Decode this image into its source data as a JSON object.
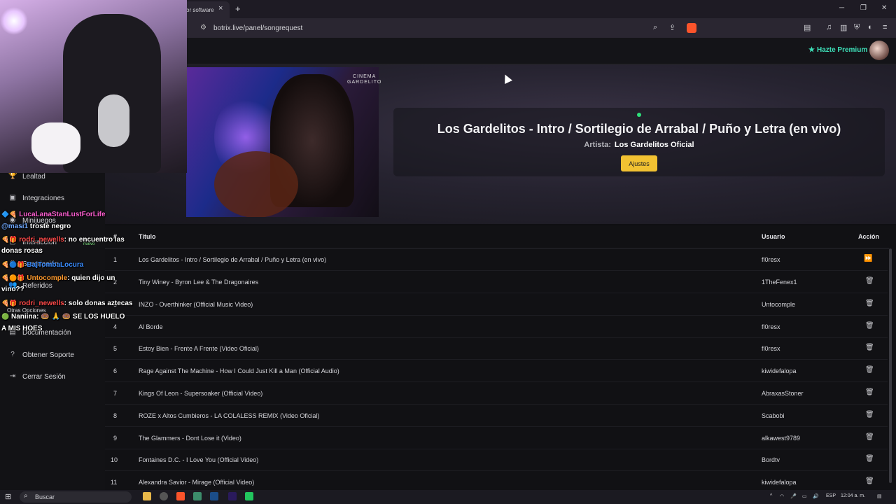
{
  "browser": {
    "tab_title": "or software",
    "tab_close": "×",
    "new_tab": "+",
    "url": "botrix.live/panel/songrequest",
    "win_min": "─",
    "win_max": "❐",
    "win_close": "✕"
  },
  "header": {
    "premium_label": "Hazte Premium"
  },
  "now_playing": {
    "video_watermark_line1": "CINEMA",
    "video_watermark_line2": "GARDELITO",
    "title": "Los Gardelitos - Intro / Sortilegio de Arrabal / Puño y Letra (en vivo)",
    "artist_label": "Artista:",
    "artist": "Los Gardelitos Oficial",
    "settings_button": "Ajustes"
  },
  "sidebar": {
    "items": [
      {
        "label": "Lealtad",
        "icon": "trophy-icon"
      },
      {
        "label": "Integraciones",
        "icon": "puzzle-icon"
      },
      {
        "label": "Minijuegos",
        "icon": "gamepad-icon"
      },
      {
        "label": "Interacción",
        "icon": "chat-icon"
      },
      {
        "label": "Suscripción",
        "icon": "crown-icon"
      },
      {
        "label": "Referidos",
        "icon": "users-icon"
      },
      {
        "label": "Otras Opciones",
        "icon": "dots-icon"
      },
      {
        "label": "Documentación",
        "icon": "book-icon"
      },
      {
        "label": "Obtener Soporte",
        "icon": "help-icon"
      },
      {
        "label": "Cerrar Sesión",
        "icon": "logout-icon"
      }
    ],
    "new_badge": "nuevo"
  },
  "chat": [
    {
      "user": "LucaLanaStanLustForLife",
      "user_color": "#ff5fd2",
      "msg": ""
    },
    {
      "user": "@masi1",
      "user_color": "#6fa8ff",
      "msg": "troste negro"
    },
    {
      "user": "rodri_newells",
      "user_color": "#ff4a4a",
      "msg": ": no encuentro las"
    },
    {
      "user": "",
      "user_color": "#ffffff",
      "msg": "donas rosas"
    },
    {
      "user": "BajTombaLocura",
      "user_color": "#3a8cff",
      "msg": ""
    },
    {
      "user": "Untocomple",
      "user_color": "#ff9a2e",
      "msg": ": quien dijo un"
    },
    {
      "user": "",
      "user_color": "#ffffff",
      "msg": "vino??"
    },
    {
      "user": "rodri_newells",
      "user_color": "#ff4a4a",
      "msg": ": solo donas aztecas"
    },
    {
      "user": "Naniina",
      "user_color": "#ffffff",
      "msg": ": 🍩 🙏 🍩 SE LOS HUELO"
    },
    {
      "user": "",
      "user_color": "#ffffff",
      "msg": "A MIS HOES"
    }
  ],
  "table": {
    "headers": {
      "num": "#",
      "title": "Título",
      "user": "Usuario",
      "action": "Acción"
    },
    "rows": [
      {
        "n": "1",
        "title": "Los Gardelitos - Intro / Sortilegio de Arrabal / Puño y Letra (en vivo)",
        "user": "fl0resx",
        "action": "skip"
      },
      {
        "n": "2",
        "title": "Tiny Winey - Byron Lee & The Dragonaires",
        "user": "1TheFenex1",
        "action": "delete"
      },
      {
        "n": "3",
        "title": "INZO - Overthinker (Official Music Video)",
        "user": "Untocomple",
        "action": "delete"
      },
      {
        "n": "4",
        "title": "Al Borde",
        "user": "fl0resx",
        "action": "delete"
      },
      {
        "n": "5",
        "title": "Estoy Bien - Frente A Frente (Video Oficial)",
        "user": "fl0resx",
        "action": "delete"
      },
      {
        "n": "6",
        "title": "Rage Against The Machine - How I Could Just Kill a Man (Official Audio)",
        "user": "kiwidefalopa",
        "action": "delete"
      },
      {
        "n": "7",
        "title": "Kings Of Leon - Supersoaker (Official Video)",
        "user": "AbraxasStoner",
        "action": "delete"
      },
      {
        "n": "8",
        "title": "ROZE x Altos Cumbieros - LA COLALESS REMIX (Video Oficial)",
        "user": "Scabobi",
        "action": "delete"
      },
      {
        "n": "9",
        "title": "The Glammers - Dont Lose it (Video)",
        "user": "alkawest9789",
        "action": "delete"
      },
      {
        "n": "10",
        "title": "Fontaines D.C. - I Love You (Official Video)",
        "user": "Bordtv",
        "action": "delete"
      },
      {
        "n": "11",
        "title": "Alexandra Savior - Mirage (Official Video)",
        "user": "kiwidefalopa",
        "action": "delete"
      }
    ]
  },
  "taskbar": {
    "search_placeholder": "Buscar",
    "lang": "ESP",
    "time": "12:04 a. m."
  },
  "colors": {
    "accent_button": "#f2c232",
    "premium": "#3ee0b9",
    "live": "#2ee07a"
  }
}
